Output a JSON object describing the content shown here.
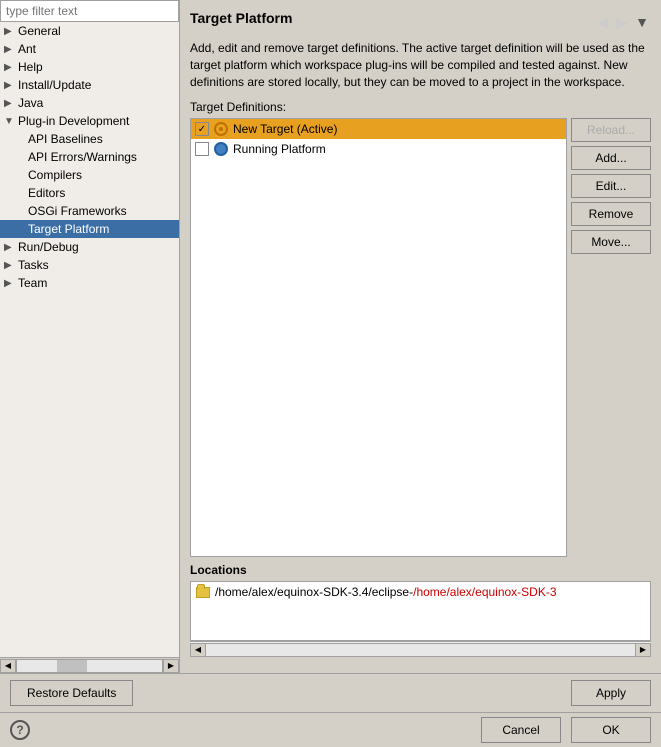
{
  "dialog": {
    "title": "Target Platform"
  },
  "sidebar": {
    "filter_placeholder": "type filter text",
    "items": [
      {
        "id": "general",
        "label": "General",
        "level": 0,
        "expandable": true,
        "expanded": false
      },
      {
        "id": "ant",
        "label": "Ant",
        "level": 0,
        "expandable": true,
        "expanded": false
      },
      {
        "id": "help",
        "label": "Help",
        "level": 0,
        "expandable": true,
        "expanded": false
      },
      {
        "id": "install-update",
        "label": "Install/Update",
        "level": 0,
        "expandable": true,
        "expanded": false
      },
      {
        "id": "java",
        "label": "Java",
        "level": 0,
        "expandable": true,
        "expanded": false
      },
      {
        "id": "plugin-development",
        "label": "Plug-in Development",
        "level": 0,
        "expandable": true,
        "expanded": true
      },
      {
        "id": "api-baselines",
        "label": "API Baselines",
        "level": 1,
        "expandable": false
      },
      {
        "id": "api-errors",
        "label": "API Errors/Warnings",
        "level": 1,
        "expandable": false
      },
      {
        "id": "compilers",
        "label": "Compilers",
        "level": 1,
        "expandable": false
      },
      {
        "id": "editors",
        "label": "Editors",
        "level": 1,
        "expandable": false
      },
      {
        "id": "osgi-frameworks",
        "label": "OSGi Frameworks",
        "level": 1,
        "expandable": false
      },
      {
        "id": "target-platform",
        "label": "Target Platform",
        "level": 1,
        "expandable": false,
        "selected": true
      },
      {
        "id": "run-debug",
        "label": "Run/Debug",
        "level": 0,
        "expandable": true,
        "expanded": false
      },
      {
        "id": "tasks",
        "label": "Tasks",
        "level": 0,
        "expandable": true,
        "expanded": false
      },
      {
        "id": "team",
        "label": "Team",
        "level": 0,
        "expandable": true,
        "expanded": false
      }
    ]
  },
  "main": {
    "title": "Target Platform",
    "description": "Add, edit and remove target definitions.  The active target definition will be used as the target platform which workspace plug-ins will be compiled and tested against.  New definitions are stored locally, but they can be moved to a project in the workspace.",
    "section_label": "Target Definitions:",
    "target_items": [
      {
        "id": "new-target",
        "label": "New Target (Active)",
        "active": true,
        "checked": true
      },
      {
        "id": "running-platform",
        "label": "Running Platform",
        "active": false,
        "checked": false
      }
    ],
    "buttons": {
      "reload": "Reload...",
      "add": "Add...",
      "edit": "Edit...",
      "remove": "Remove",
      "move": "Move..."
    },
    "locations": {
      "label": "Locations",
      "items": [
        {
          "path_black": "/home/alex/equinox-SDK-3.4/eclipse",
          "separator": " - ",
          "path_red": "/home/alex/equinox-SDK-3"
        }
      ]
    }
  },
  "footer": {
    "restore_defaults": "Restore Defaults",
    "apply": "Apply",
    "cancel": "Cancel",
    "ok": "OK"
  },
  "nav": {
    "back_disabled": true,
    "forward_disabled": true
  }
}
